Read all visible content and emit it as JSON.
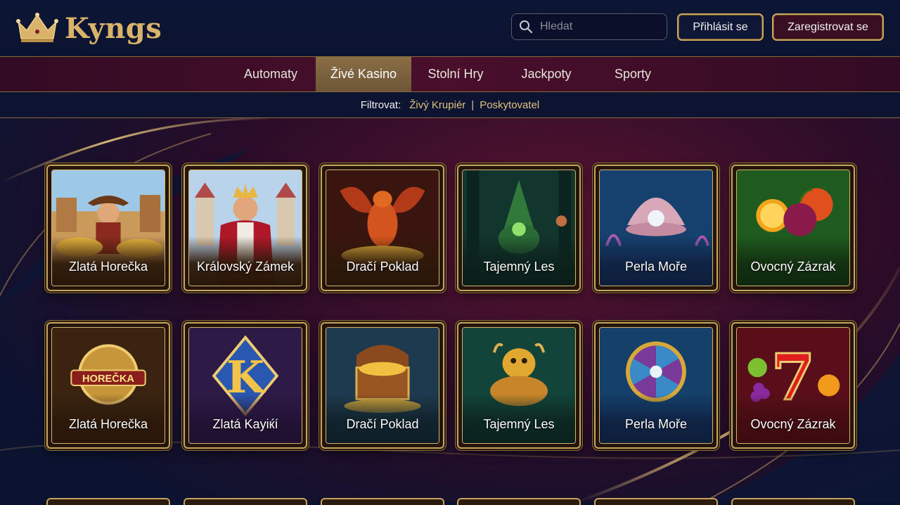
{
  "brand": {
    "name": "Kyngs",
    "logo_icon": "crown-icon",
    "accent": "#d9b36a"
  },
  "search": {
    "placeholder": "Hledat",
    "icon": "search-icon"
  },
  "auth": {
    "login_label": "Přihlásit se",
    "register_label": "Zaregistrovat se"
  },
  "nav": {
    "items": [
      {
        "label": "Automaty",
        "active": false
      },
      {
        "label": "Živé Kasino",
        "active": true
      },
      {
        "label": "Stolní Hry",
        "active": false
      },
      {
        "label": "Jackpoty",
        "active": false
      },
      {
        "label": "Sporty",
        "active": false
      }
    ]
  },
  "filter": {
    "label": "Filtrovat:",
    "options": [
      "Živý Krupiér",
      "Poskytovatel"
    ],
    "separator": "|"
  },
  "games": {
    "row1": [
      {
        "title": "Zlatá Horečka",
        "icon": "cowboy-miner-art"
      },
      {
        "title": "Královský Zámek",
        "icon": "king-castle-art"
      },
      {
        "title": "Dračí Poklad",
        "icon": "dragon-art"
      },
      {
        "title": "Tajemný Les",
        "icon": "forest-wizard-art"
      },
      {
        "title": "Perla Moře",
        "icon": "pearl-shell-art"
      },
      {
        "title": "Ovocný Zázrak",
        "icon": "fruits-art"
      }
    ],
    "row2": [
      {
        "title": "Zlatá Horečka",
        "icon": "horecka-badge-art",
        "badge_text": "HOREČKA"
      },
      {
        "title": "Zlatá Kayiќí",
        "icon": "letter-k-art",
        "badge_text": "K"
      },
      {
        "title": "Dračí Poklad",
        "icon": "treasure-chest-art"
      },
      {
        "title": "Tajemný Les",
        "icon": "golden-frog-art"
      },
      {
        "title": "Perla Moře",
        "icon": "fortune-wheel-art"
      },
      {
        "title": "Ovocný Zázrak",
        "icon": "lucky-seven-art",
        "badge_text": "7"
      }
    ]
  },
  "colors": {
    "gold": "#c9a45e",
    "nav_bg": "#4a0f2a",
    "nav_active": "#8a6e46",
    "page_bg": "#0b1330"
  }
}
